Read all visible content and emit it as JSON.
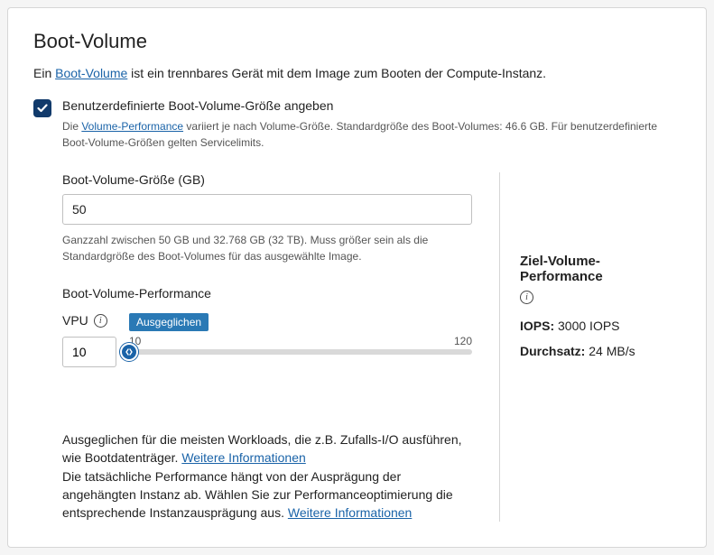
{
  "title": "Boot-Volume",
  "intro_prefix": "Ein ",
  "intro_link": "Boot-Volume",
  "intro_suffix": " ist ein trennbares Gerät mit dem Image zum Booten der Compute-Instanz.",
  "custom_size": {
    "checkbox_label": "Benutzerdefinierte Boot-Volume-Größe angeben",
    "sub_prefix": "Die ",
    "sub_link": "Volume-Performance",
    "sub_suffix": " variiert je nach Volume-Größe. Standardgröße des Boot-Volumes: 46.6 GB. Für benutzerdefinierte Boot-Volume-Größen gelten Servicelimits."
  },
  "size_field": {
    "label": "Boot-Volume-Größe (GB)",
    "value": "50",
    "helper": "Ganzzahl zwischen 50 GB und 32.768 GB (32 TB). Muss größer sein als die Standardgröße des Boot-Volumes für das ausgewählte Image."
  },
  "perf": {
    "section_label": "Boot-Volume-Performance",
    "vpu_label": "VPU",
    "vpu_value": "10",
    "badge": "Ausgeglichen",
    "slider_min": "10",
    "slider_max": "120",
    "desc1_text": "Ausgeglichen für die meisten Workloads, die z.B. Zufalls-I/O ausführen, wie Bootdatenträger. ",
    "desc1_link": "Weitere Informationen",
    "desc2_text": "Die tatsächliche Performance hängt von der Ausprägung der angehängten Instanz ab. Wählen Sie zur Performanceoptimierung die entsprechende Instanzausprägung aus. ",
    "desc2_link": "Weitere Informationen"
  },
  "target": {
    "heading": "Ziel-Volume-Performance",
    "iops_key": "IOPS:",
    "iops_val": " 3000 IOPS",
    "throughput_key": "Durchsatz:",
    "throughput_val": " 24 MB/s"
  }
}
